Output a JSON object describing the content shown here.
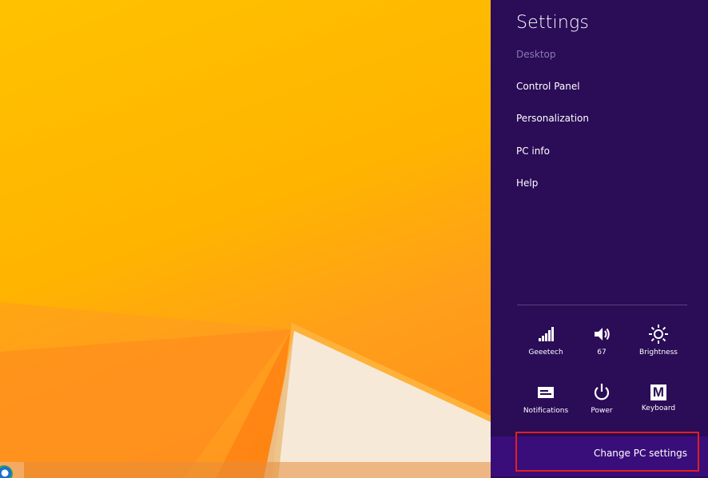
{
  "charm_bar": {
    "title": "Settings",
    "context": "Desktop",
    "items": [
      {
        "label": "Control Panel"
      },
      {
        "label": "Personalization"
      },
      {
        "label": "PC info"
      },
      {
        "label": "Help"
      }
    ],
    "quick_settings": [
      {
        "label": "Geeetech",
        "icon": "wifi-signal-icon"
      },
      {
        "label": "67",
        "icon": "volume-icon"
      },
      {
        "label": "Brightness",
        "icon": "brightness-icon"
      },
      {
        "label": "Notifications",
        "icon": "notifications-icon"
      },
      {
        "label": "Power",
        "icon": "power-icon"
      },
      {
        "label": "Keyboard",
        "icon": "keyboard-icon",
        "glyph": "M"
      }
    ],
    "footer": {
      "label": "Change PC settings"
    }
  },
  "colors": {
    "charm_bg": "#2a0c57",
    "footer_bg": "#3a0e7a",
    "highlight": "#e0201e",
    "wallpaper": "#ffb400"
  }
}
